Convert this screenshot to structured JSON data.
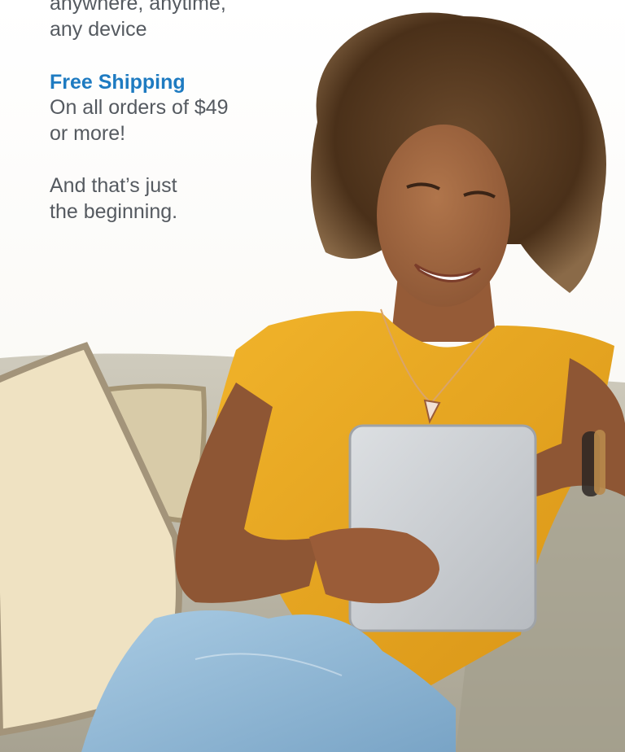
{
  "promo": {
    "intro_line1": "anywhere, anytime,",
    "intro_line2": "any device",
    "shipping_heading": "Free Shipping",
    "shipping_line1": "On all orders of $49",
    "shipping_line2": "or more!",
    "closing_line1": "And that’s just",
    "closing_line2": "the beginning."
  },
  "colors": {
    "heading": "#1e7bc1",
    "body_text": "#555a60",
    "shirt": "#e8a820",
    "jeans": "#8fb7d4",
    "sofa": "#b9b4a4",
    "pillow": "#efe2c2",
    "tablet": "#c9ccd0"
  },
  "image": {
    "icon": "woman-on-sofa-with-tablet-photo"
  }
}
